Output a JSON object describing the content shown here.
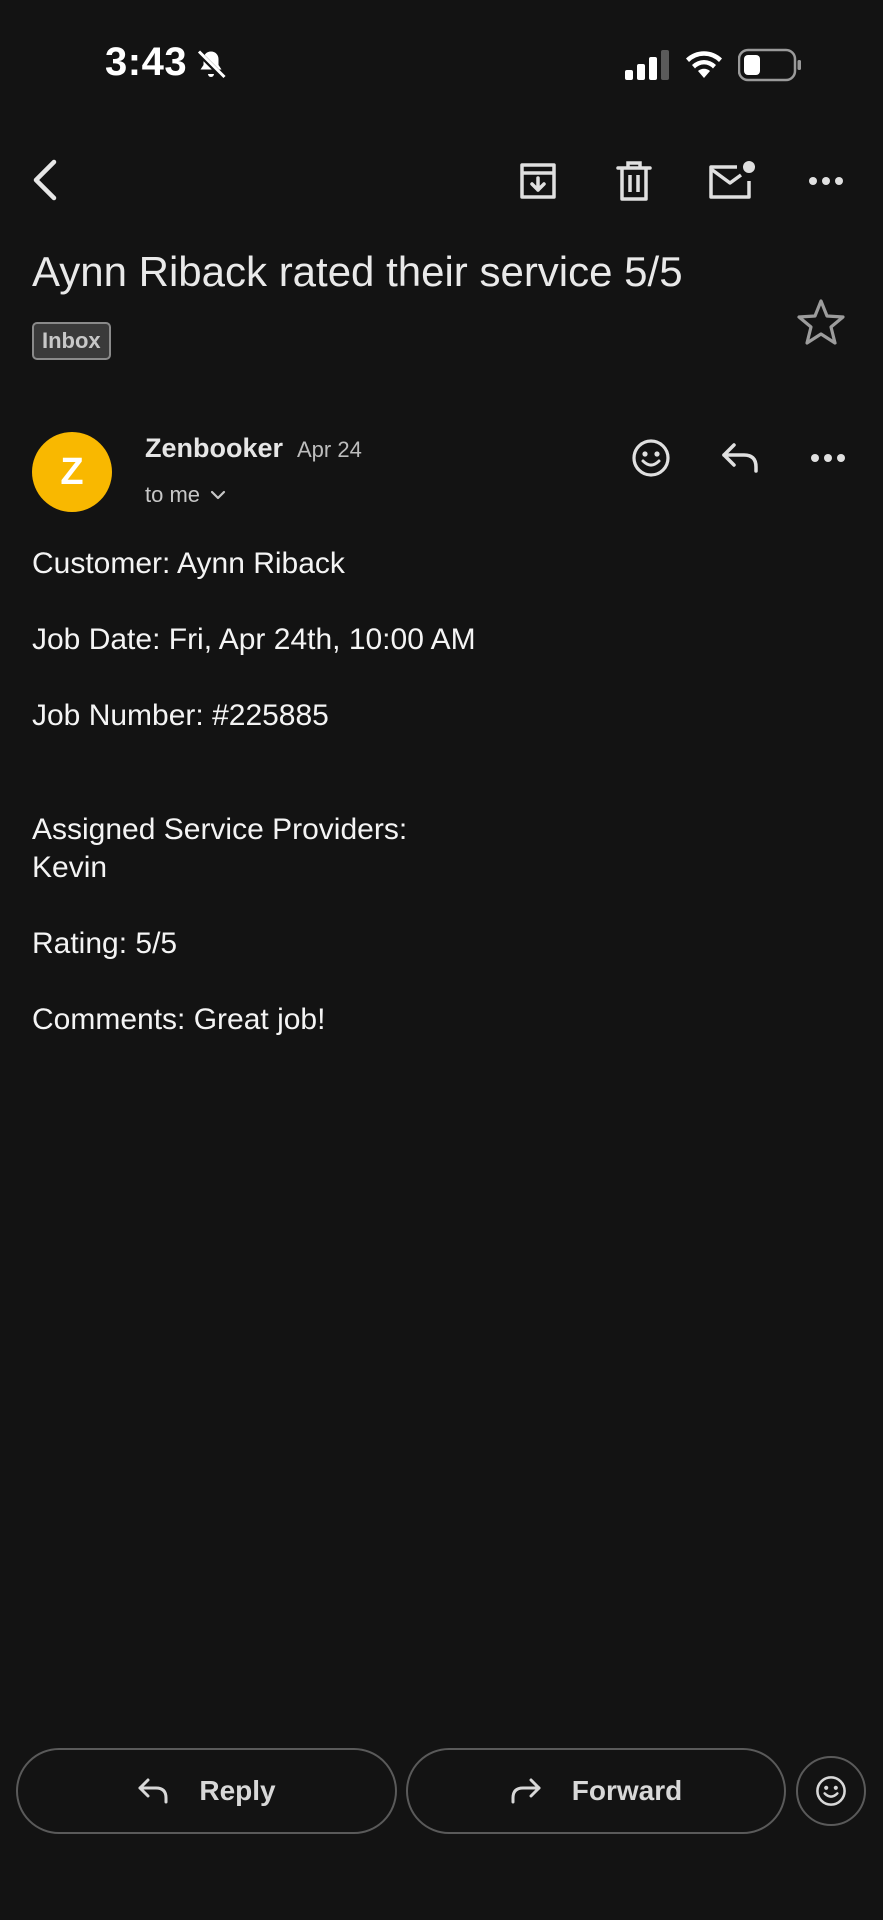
{
  "status_bar": {
    "time": "3:43",
    "icons": [
      "bell-slash-icon",
      "signal-icon",
      "wifi-icon",
      "battery-icon"
    ]
  },
  "toolbar": {
    "icons": [
      "back-arrow-icon",
      "archive-icon",
      "trash-icon",
      "mark-unread-icon",
      "more-horizontal-icon"
    ]
  },
  "email": {
    "subject": "Aynn Riback rated their service 5/5",
    "label": "Inbox",
    "sender": {
      "initial": "Z",
      "name": "Zenbooker",
      "date": "Apr 24",
      "recipient": "to me",
      "avatar_color": "#f9b800"
    },
    "body": {
      "customer": "Customer: Aynn Riback",
      "job_date": "Job Date: Fri, Apr 24th, 10:00 AM",
      "job_number": "Job Number: #225885",
      "providers_heading": "Assigned Service Providers:",
      "provider": "Kevin",
      "rating": "Rating: 5/5",
      "comments": "Comments: Great job!"
    }
  },
  "actions": {
    "reply_label": "Reply",
    "forward_label": "Forward"
  },
  "colors": {
    "background": "#131313",
    "text": "#ededed",
    "avatar": "#f9b800"
  }
}
